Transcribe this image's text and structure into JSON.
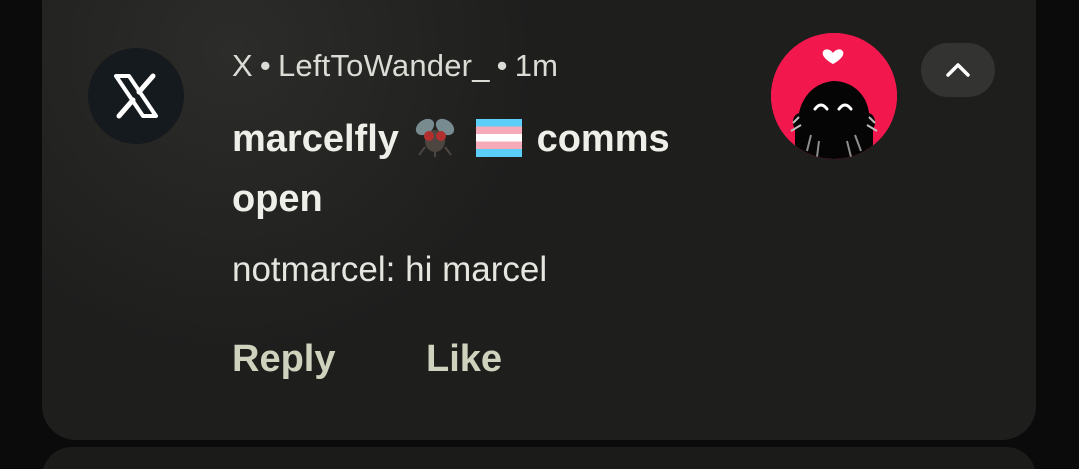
{
  "notification": {
    "app_name": "X",
    "separator": "•",
    "account": "LeftToWander_",
    "time": "1m",
    "title_prefix": "marcelfly",
    "title_suffix": "comms open",
    "title_emojis": [
      "fly-emoji",
      "transgender-flag-emoji"
    ],
    "message": "notmarcel: hi marcel",
    "actions": {
      "reply": "Reply",
      "like": "Like"
    },
    "icons": {
      "app": "x-logo-icon",
      "expand_toggle": "chevron-up-icon",
      "avatar": "avatar-image"
    },
    "colors": {
      "avatar_bg": "#f2184e",
      "action_text": "#cfd3bd",
      "card_bg": "#1e1e1d"
    }
  }
}
